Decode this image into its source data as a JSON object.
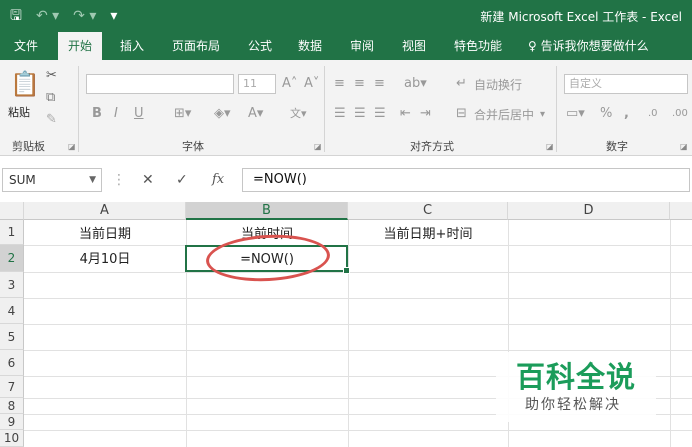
{
  "titlebar": {
    "save_icon": "save-icon",
    "undo_icon": "undo-icon",
    "redo_icon": "redo-icon",
    "customize_icon": "qat-dropdown-icon",
    "title": "新建 Microsoft Excel 工作表 - Excel"
  },
  "tabs": [
    "文件",
    "开始",
    "插入",
    "页面布局",
    "公式",
    "数据",
    "审阅",
    "视图",
    "特色功能"
  ],
  "active_tab": "开始",
  "tell_me": "♀ 告诉我你想要做什么",
  "ribbon": {
    "paste_label": "粘贴",
    "clipboard_label": "剪贴板",
    "font_label": "字体",
    "align_label": "对齐方式",
    "number_label": "数字",
    "font_size": "11",
    "wrap_text": "自动换行",
    "merge_center": "合并后居中",
    "number_format": "自定义",
    "bold": "B",
    "italic": "I",
    "underline": "U",
    "percent": "%",
    "comma": ","
  },
  "formula_bar": {
    "name_box": "SUM",
    "cancel": "✕",
    "enter": "✓",
    "fx": "fx",
    "formula": "=NOW()"
  },
  "grid": {
    "columns": [
      "A",
      "B",
      "C",
      "D"
    ],
    "rows": [
      "1",
      "2",
      "3",
      "4",
      "5",
      "6",
      "7",
      "8",
      "9",
      "10"
    ],
    "cells": {
      "A1": "当前日期",
      "B1": "当前时间",
      "C1": "当前日期+时间",
      "A2": "4月10日",
      "B2": "=NOW()"
    }
  },
  "watermark": {
    "title": "百科全说",
    "subtitle": "助你轻松解决"
  },
  "colors": {
    "excel_green": "#217346",
    "annotation_red": "#d9534f",
    "watermark_green": "#1b9c5a"
  }
}
